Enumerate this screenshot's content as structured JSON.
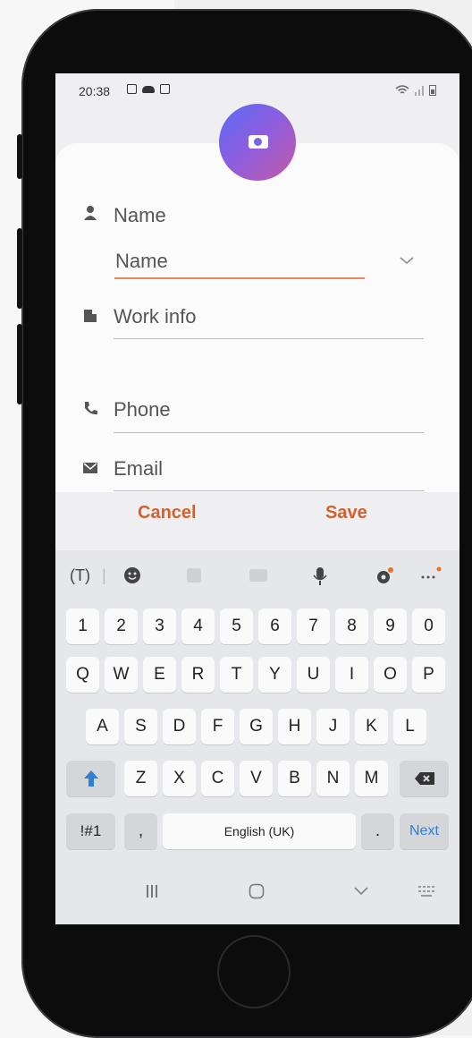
{
  "status_bar": {
    "time": "20:38"
  },
  "form": {
    "name_section_label": "Name",
    "name_placeholder": "Name",
    "work_info_placeholder": "Work info",
    "phone_placeholder": "Phone",
    "email_placeholder": "Email"
  },
  "actions": {
    "cancel": "Cancel",
    "save": "Save"
  },
  "keyboard": {
    "number_row": [
      "1",
      "2",
      "3",
      "4",
      "5",
      "6",
      "7",
      "8",
      "9",
      "0"
    ],
    "row1": [
      "Q",
      "W",
      "E",
      "R",
      "T",
      "Y",
      "U",
      "I",
      "O",
      "P"
    ],
    "row2": [
      "A",
      "S",
      "D",
      "F",
      "G",
      "H",
      "J",
      "K",
      "L"
    ],
    "row3": [
      "Z",
      "X",
      "C",
      "V",
      "B",
      "N",
      "M"
    ],
    "symbols_key": "!#1",
    "comma_key": ",",
    "space_label": "English (UK)",
    "period_key": ".",
    "next_key": "Next"
  },
  "colors": {
    "accent": "#d4602a",
    "active_underline": "#e58a5a",
    "next_blue": "#2e7fd6"
  }
}
